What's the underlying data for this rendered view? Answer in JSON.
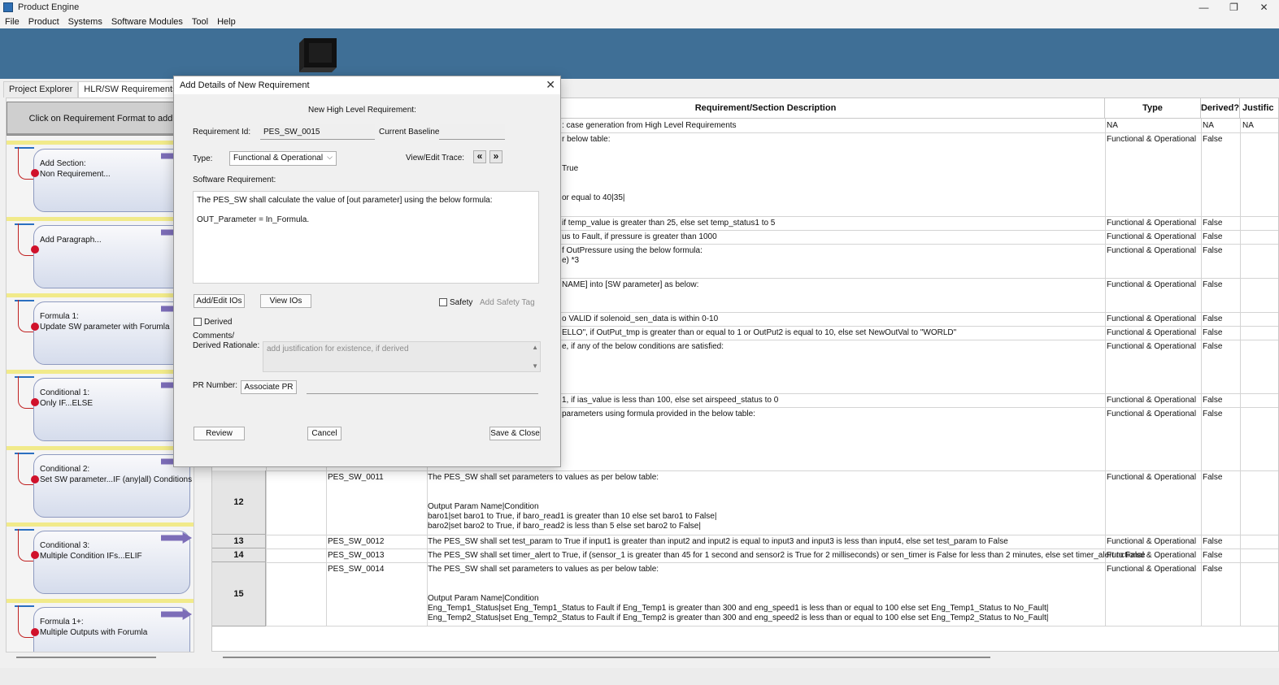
{
  "window": {
    "title": "Product Engine",
    "controls": [
      "—",
      "❐",
      "✕"
    ]
  },
  "menu": [
    "File",
    "Product",
    "Systems",
    "Software Modules",
    "Tool",
    "Help"
  ],
  "left_tabs": [
    "Project Explorer",
    "HLR/SW Requirements"
  ],
  "format_header": "Click on Requirement Format to add",
  "formats": [
    {
      "line1": "Add Section:",
      "line2": "Non Requirement..."
    },
    {
      "line1": "Add Paragraph...",
      "line2": ""
    },
    {
      "line1": "Formula 1:",
      "line2": "Update SW parameter with Forumla"
    },
    {
      "line1": "Conditional 1:",
      "line2": "Only IF...ELSE"
    },
    {
      "line1": "Conditional 2:",
      "line2": "Set SW parameter...IF (any|all) Conditions"
    },
    {
      "line1": "Conditional 3:",
      "line2": "Multiple Condition IFs...ELIF"
    },
    {
      "line1": "Formula 1+:",
      "line2": "Multiple Outputs with Forumla"
    }
  ],
  "table": {
    "headers": [
      "Requirement/Section Description",
      "Type",
      "Derived?",
      "Justific"
    ],
    "rows": [
      {
        "desc": ": case generation from High Level Requirements",
        "type": "NA",
        "derived": "NA",
        "just": "NA"
      },
      {
        "desc": "r below table:\n\n\nTrue\n\n\nor equal to 40|35|",
        "type": "Functional & Operational",
        "derived": "False",
        "just": ""
      },
      {
        "desc": "if temp_value is greater than 25, else set temp_status1 to 5",
        "type": "Functional & Operational",
        "derived": "False",
        "just": ""
      },
      {
        "desc": "us to Fault, if pressure is greater than 1000",
        "type": "Functional & Operational",
        "derived": "False",
        "just": ""
      },
      {
        "desc": "f OutPressure using the below formula:\ne) *3",
        "type": "Functional & Operational",
        "derived": "False",
        "just": ""
      },
      {
        "desc": "NAME] into [SW parameter] as below:",
        "type": "Functional & Operational",
        "derived": "False",
        "just": ""
      },
      {
        "desc": "o VALID if solenoid_sen_data is within 0-10",
        "type": "Functional & Operational",
        "derived": "False",
        "just": ""
      },
      {
        "desc": "ELLO\", if OutPut_tmp is greater than or equal to 1 or OutPut2 is equal to 10, else set NewOutVal to \"WORLD\"",
        "type": "Functional & Operational",
        "derived": "False",
        "just": ""
      },
      {
        "desc": "e, if any of the below conditions are satisfied:",
        "type": "Functional & Operational",
        "derived": "False",
        "just": ""
      },
      {
        "desc": "1, if ias_value is less than 100, else set airspeed_status to 0",
        "type": "Functional & Operational",
        "derived": "False",
        "just": ""
      },
      {
        "desc": "parameters using formula provided in the below table:",
        "type": "Functional & Operational",
        "derived": "False",
        "just": ""
      },
      {
        "num": "12",
        "id": "PES_SW_0011",
        "desc": "The PES_SW shall set parameters to values as per below table:\n\n\nOutput Param Name|Condition\nbaro1|set baro1 to True, if baro_read1 is greater than 10 else set baro1 to False|\nbaro2|set baro2 to True, if baro_read2 is less than 5 else set baro2 to False|",
        "type": "Functional & Operational",
        "derived": "False",
        "just": ""
      },
      {
        "num": "13",
        "id": "PES_SW_0012",
        "desc": "The PES_SW shall set test_param to True if input1 is greater than input2 and input2 is equal to input3 and input3 is less than input4, else set test_param to False",
        "type": "Functional & Operational",
        "derived": "False",
        "just": ""
      },
      {
        "num": "14",
        "id": "PES_SW_0013",
        "desc": "The PES_SW shall set timer_alert to True, if (sensor_1 is greater than 45 for 1 second and sensor2 is True for 2 milliseconds) or sen_timer is False for less than 2 minutes, else set timer_alert to False",
        "type": "Functional & Operational",
        "derived": "False",
        "just": ""
      },
      {
        "num": "15",
        "id": "PES_SW_0014",
        "desc": "The PES_SW shall set parameters to values as per below table:\n\n\nOutput Param Name|Condition\nEng_Temp1_Status|set Eng_Temp1_Status to Fault if Eng_Temp1 is greater than 300 and eng_speed1 is less than or equal to 100 else set Eng_Temp1_Status to No_Fault|\nEng_Temp2_Status|set Eng_Temp2_Status to Fault if Eng_Temp2 is greater than 300 and eng_speed2 is less than or equal to 100 else set Eng_Temp2_Status to No_Fault|",
        "type": "Functional & Operational",
        "derived": "False",
        "just": ""
      }
    ]
  },
  "dialog": {
    "title": "Add Details of New Requirement",
    "heading": "New High Level Requirement:",
    "req_id_label": "Requirement Id:",
    "req_id_value": "PES_SW_0015",
    "baseline_label": "Current Baseline:",
    "baseline_value": "",
    "type_label": "Type:",
    "type_value": "Functional & Operational",
    "trace_label": "View/Edit Trace:",
    "trace_prev": "«",
    "trace_next": "»",
    "sw_req_label": "Software Requirement:",
    "sw_req_text": "The PES_SW shall calculate the value of [out parameter] using the below formula:\n\nOUT_Parameter = In_Formula.",
    "add_edit_ios": "Add/Edit IOs",
    "view_ios": "View IOs",
    "safety_label": "Safety",
    "safety_tag": "Add Safety Tag",
    "derived_label": "Derived",
    "comments_label": "Comments/",
    "rationale_label": "Derived Rationale:",
    "rationale_placeholder": "add justification for existence, if derived",
    "pr_label": "PR Number:",
    "associate_pr": "Associate PR",
    "pr_value": "",
    "review": "Review",
    "cancel": "Cancel",
    "save_close": "Save & Close"
  }
}
